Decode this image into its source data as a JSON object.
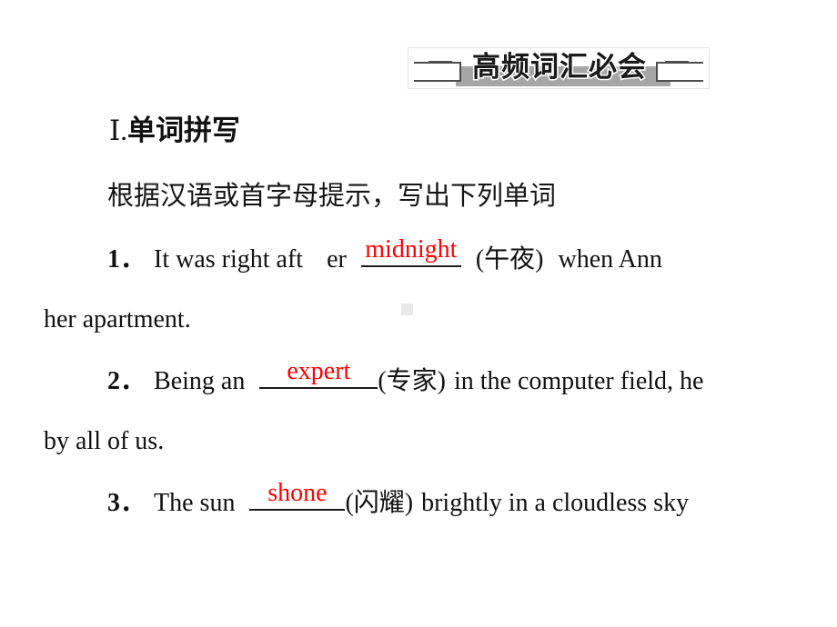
{
  "slide": {
    "banner": {
      "title": "高频词汇必会",
      "bar_color": "#a6a6a6",
      "bracket_color": "#4d4d4d"
    },
    "section": {
      "numeral": "Ⅰ",
      "separator": ".",
      "title": "单词拼写"
    },
    "instruction": "根据汉语或首字母提示，写出下列单词",
    "answer_color": "#ff0000",
    "questions": [
      {
        "number": "1",
        "number_sep": "．",
        "pre": "It was right aft",
        "pre_tail": "er",
        "answer": "midnight",
        "hint": "(午夜)",
        "post": "when Ann",
        "continuation": "her apartment."
      },
      {
        "number": "2",
        "number_sep": "．",
        "pre": "Being an",
        "answer": "expert",
        "hint": "(专家)",
        "post": "in the computer field, he",
        "continuation": "by all of us."
      },
      {
        "number": "3",
        "number_sep": "．",
        "pre": "The sun",
        "answer": "shone",
        "hint": "(闪耀)",
        "post": "brightly in a cloudless sky",
        "continuation": ""
      }
    ]
  }
}
